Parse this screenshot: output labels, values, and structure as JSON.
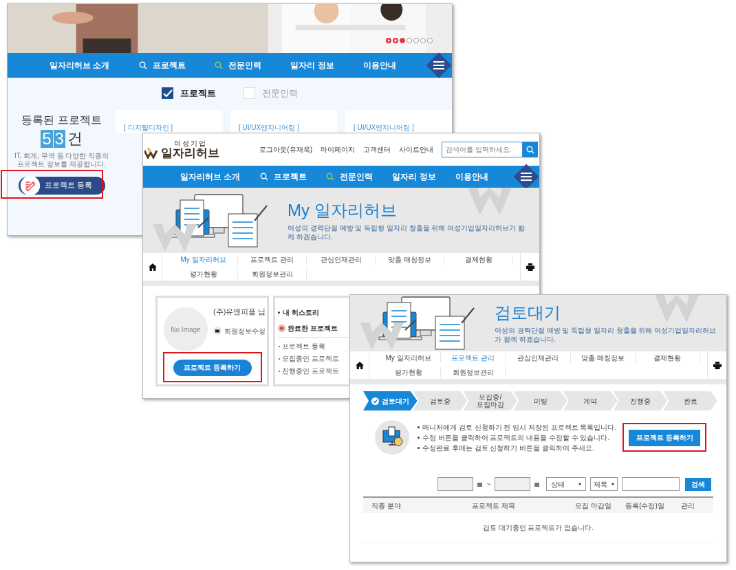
{
  "main_page": {
    "banner": {
      "kind": "picture",
      "slides": [
        {
          "selected": true
        },
        {
          "selected": false
        },
        {
          "selected": false
        },
        {
          "selected": false
        },
        {
          "selected": false
        }
      ]
    },
    "nav": [
      {
        "label": "일자리허브 소개",
        "kind": "plain"
      },
      {
        "label": "프로젝트",
        "kind": "search",
        "color": "#ffffff"
      },
      {
        "label": "전문인력",
        "kind": "search",
        "color": "#9ad14b"
      },
      {
        "label": "일자리 정보",
        "kind": "plain"
      },
      {
        "label": "이용안내",
        "kind": "plain"
      }
    ],
    "filters": [
      {
        "label": "프로젝트",
        "checked": true
      },
      {
        "label": "전문인력",
        "checked": false
      }
    ],
    "stats": {
      "title": "등록된 프로젝트",
      "digits": [
        "5",
        "3"
      ],
      "unit": "건",
      "description": [
        "IT, 회계, 무역 등 다양한 직종의",
        "프로젝트 정보를 제공합니다."
      ]
    },
    "register_button": {
      "label": "프로젝트 등록",
      "highlighted": true
    },
    "cards": [
      {
        "category": "[ 디지털디자인 ]"
      },
      {
        "category": "[ UI/UX엔지니어링 ]"
      },
      {
        "category": "[ UI/UX엔지니어링 ]"
      }
    ]
  },
  "my_page": {
    "logo": {
      "small": "여성기업",
      "big": "일자리허브"
    },
    "top_links": [
      "로그아웃(유재욱)",
      "마이페이지",
      "고객센터",
      "사이트안내"
    ],
    "search": {
      "placeholder": "검색어를 입력하세요."
    },
    "nav": [
      {
        "label": "일자리허브 소개",
        "kind": "plain"
      },
      {
        "label": "프로젝트",
        "kind": "search",
        "color": "#ffffff"
      },
      {
        "label": "전문인력",
        "kind": "search",
        "color": "#9ad14b"
      },
      {
        "label": "일자리 정보",
        "kind": "plain"
      },
      {
        "label": "이용안내",
        "kind": "plain"
      }
    ],
    "banner": {
      "title": "My 일자리허브",
      "subtitle": "여성의 경력단절 예방 및 독립형 일자리 창출을 위해 여성기업일자리허브가 함께 하겠습니다."
    },
    "submenu": [
      {
        "label": "My 일자리허브",
        "selected": true
      },
      {
        "label": "프로젝트 관리",
        "selected": false
      },
      {
        "label": "관심인재관리",
        "selected": false
      },
      {
        "label": "맞춤 매칭정보",
        "selected": false
      },
      {
        "label": "결제현황",
        "selected": false
      },
      {
        "label": "평가현황",
        "selected": false
      },
      {
        "label": "회원정보관리",
        "selected": false
      }
    ],
    "profile": {
      "avatar": "No Image",
      "name": "(주)유앤피플 님",
      "edit": "회원정보수정",
      "button": {
        "label": "프로젝트 등록하기",
        "highlighted": true
      }
    },
    "history": {
      "title": "내 히스토리",
      "section": "완료한 프로젝트",
      "items": [
        "프로젝트 등록",
        "모집중인 프로젝트",
        "진행중인 프로젝트"
      ]
    }
  },
  "review_page": {
    "banner": {
      "title": "검토대기",
      "subtitle": "여성의 경력단절 예방 및 독립형 일자리 창출을 위해 여성기업일자리허브가 함께 하겠습니다."
    },
    "submenu": [
      {
        "label": "My 일자리허브",
        "selected": false
      },
      {
        "label": "프로젝트 관리",
        "selected": true
      },
      {
        "label": "관심인재관리",
        "selected": false
      },
      {
        "label": "맞춤 매칭정보",
        "selected": false
      },
      {
        "label": "결제현황",
        "selected": false
      },
      {
        "label": "평가현황",
        "selected": false
      },
      {
        "label": "회원정보관리",
        "selected": false
      }
    ],
    "steps": [
      {
        "lines": [
          "검토대기"
        ],
        "selected": true
      },
      {
        "lines": [
          "검토중"
        ],
        "selected": false
      },
      {
        "lines": [
          "모집중/",
          "모집마감"
        ],
        "selected": false
      },
      {
        "lines": [
          "미팅"
        ],
        "selected": false
      },
      {
        "lines": [
          "계약"
        ],
        "selected": false
      },
      {
        "lines": [
          "진행중"
        ],
        "selected": false
      },
      {
        "lines": [
          "완료"
        ],
        "selected": false
      }
    ],
    "info": [
      "매니저에게 검토 신청하기 전 임시 저장된 프로젝트 목록입니다.",
      "수정 버튼을 클릭하여 프로젝트의 내용을 수정할 수 있습니다.",
      "수정완료 후에는 검토 신청하기 버튼을 클릭하여 주세요."
    ],
    "register_button": {
      "label": "프로젝트 등록하기",
      "highlighted": true
    },
    "filter": {
      "separator": "~",
      "status": "상태",
      "field": "제목",
      "button": "검색"
    },
    "table": {
      "columns": [
        "직종 분야",
        "프로젝트 제목",
        "모집 마감일",
        "등록(수정)일",
        "관리"
      ],
      "empty_message": "검토 대기중인 프로젝트가 없습니다."
    }
  }
}
